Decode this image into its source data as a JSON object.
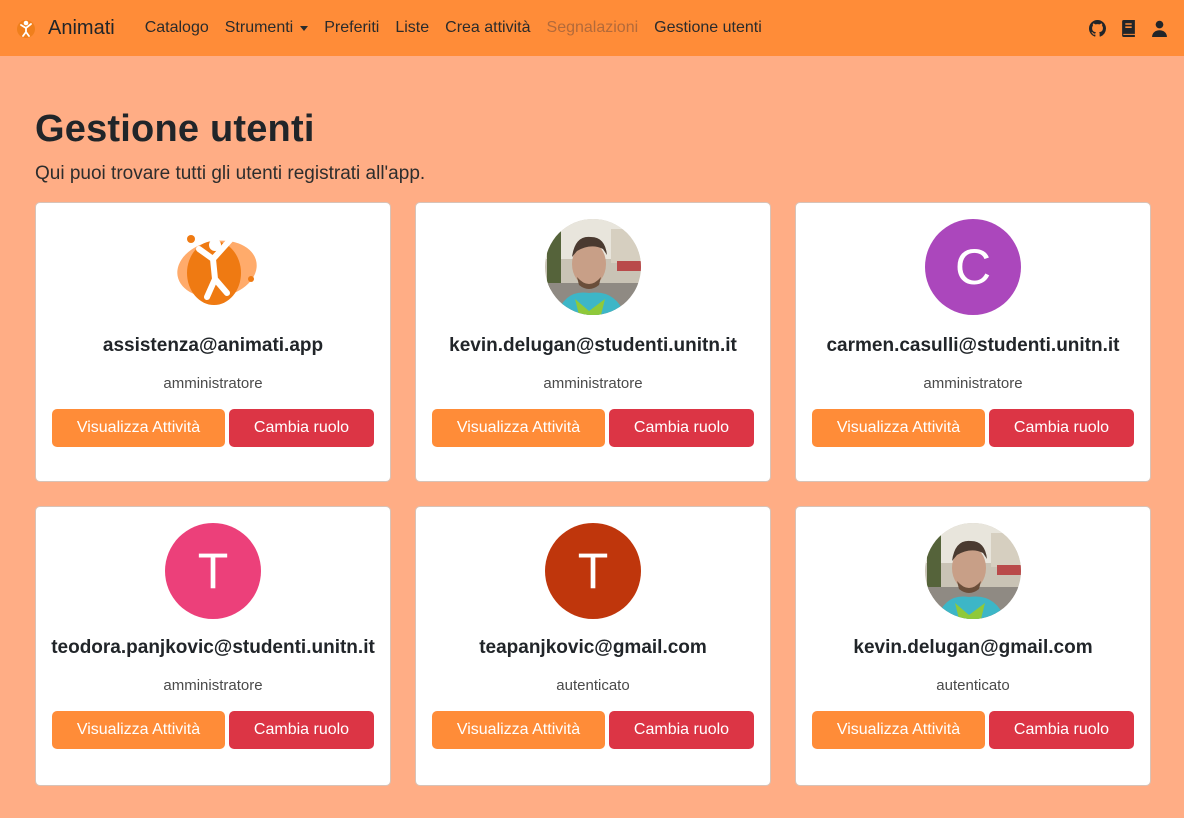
{
  "navbar": {
    "brand": "Animati",
    "links": [
      {
        "label": "Catalogo"
      },
      {
        "label": "Strumenti"
      },
      {
        "label": "Preferiti"
      },
      {
        "label": "Liste"
      },
      {
        "label": "Crea attività"
      },
      {
        "label": "Segnalazioni"
      },
      {
        "label": "Gestione utenti"
      }
    ],
    "right_icons": [
      "github-icon",
      "book-icon",
      "user-icon"
    ]
  },
  "page": {
    "title": "Gestione utenti",
    "subtitle": "Qui puoi trovare tutti gli utenti registrati all'app."
  },
  "buttons": {
    "view": "Visualizza Attività",
    "role": "Cambia ruolo"
  },
  "users": [
    {
      "email": "assistenza@animati.app",
      "role": "amministratore",
      "avatar": {
        "type": "logo"
      }
    },
    {
      "email": "kevin.delugan@studenti.unitn.it",
      "role": "amministratore",
      "avatar": {
        "type": "photo"
      }
    },
    {
      "email": "carmen.casulli@studenti.unitn.it",
      "role": "amministratore",
      "avatar": {
        "type": "initial",
        "letter": "C",
        "color": "#ab47bc"
      }
    },
    {
      "email": "teodora.panjkovic@studenti.unitn.it",
      "role": "amministratore",
      "avatar": {
        "type": "initial",
        "letter": "T",
        "color": "#ec407a"
      }
    },
    {
      "email": "teapanjkovic@gmail.com",
      "role": "autenticato",
      "avatar": {
        "type": "initial",
        "letter": "T",
        "color": "#bf360c"
      }
    },
    {
      "email": "kevin.delugan@gmail.com",
      "role": "autenticato",
      "avatar": {
        "type": "photo"
      }
    }
  ],
  "colors": {
    "navbar": "#ff8c38",
    "background": "#ffad85",
    "primary_button": "#ff8c38",
    "danger_button": "#dc3545"
  }
}
